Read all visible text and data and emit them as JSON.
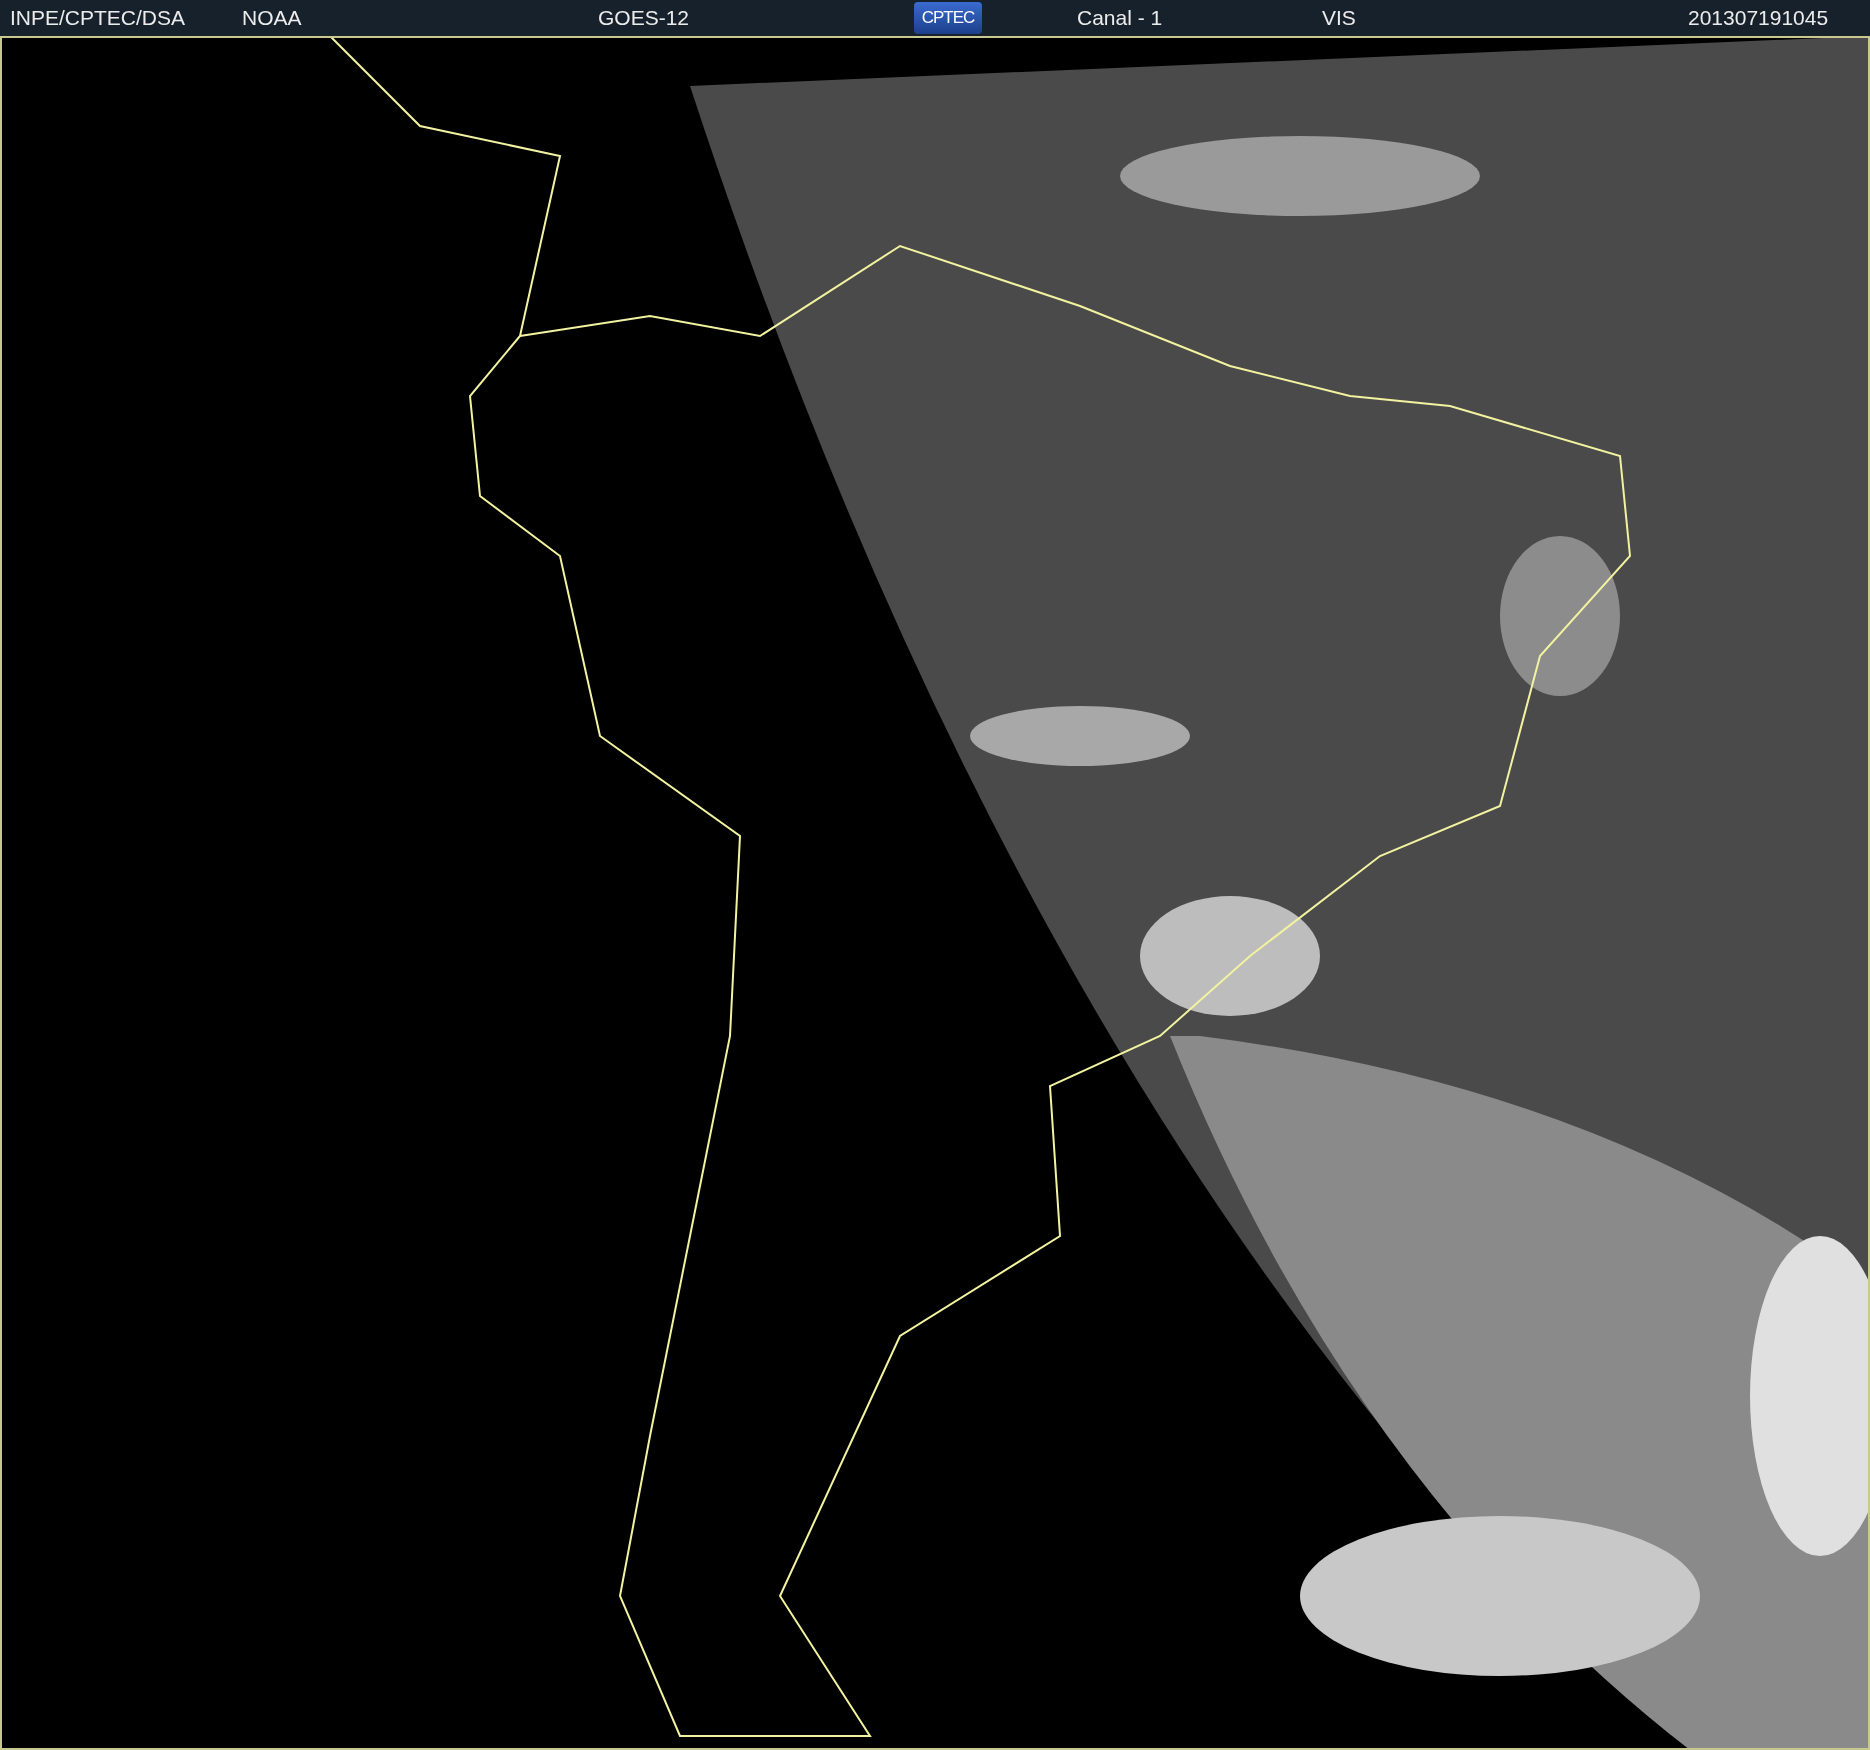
{
  "header": {
    "items": [
      {
        "kind": "text",
        "text": "INPE/CPTEC/DSA"
      },
      {
        "kind": "text",
        "text": "NOAA"
      },
      {
        "kind": "text",
        "text": "GOES-12"
      },
      {
        "kind": "logo",
        "text": "CPTEC"
      },
      {
        "kind": "text",
        "text": "Canal - 1"
      },
      {
        "kind": "text",
        "text": "VIS"
      },
      {
        "kind": "text",
        "text": "201307191045"
      }
    ]
  }
}
